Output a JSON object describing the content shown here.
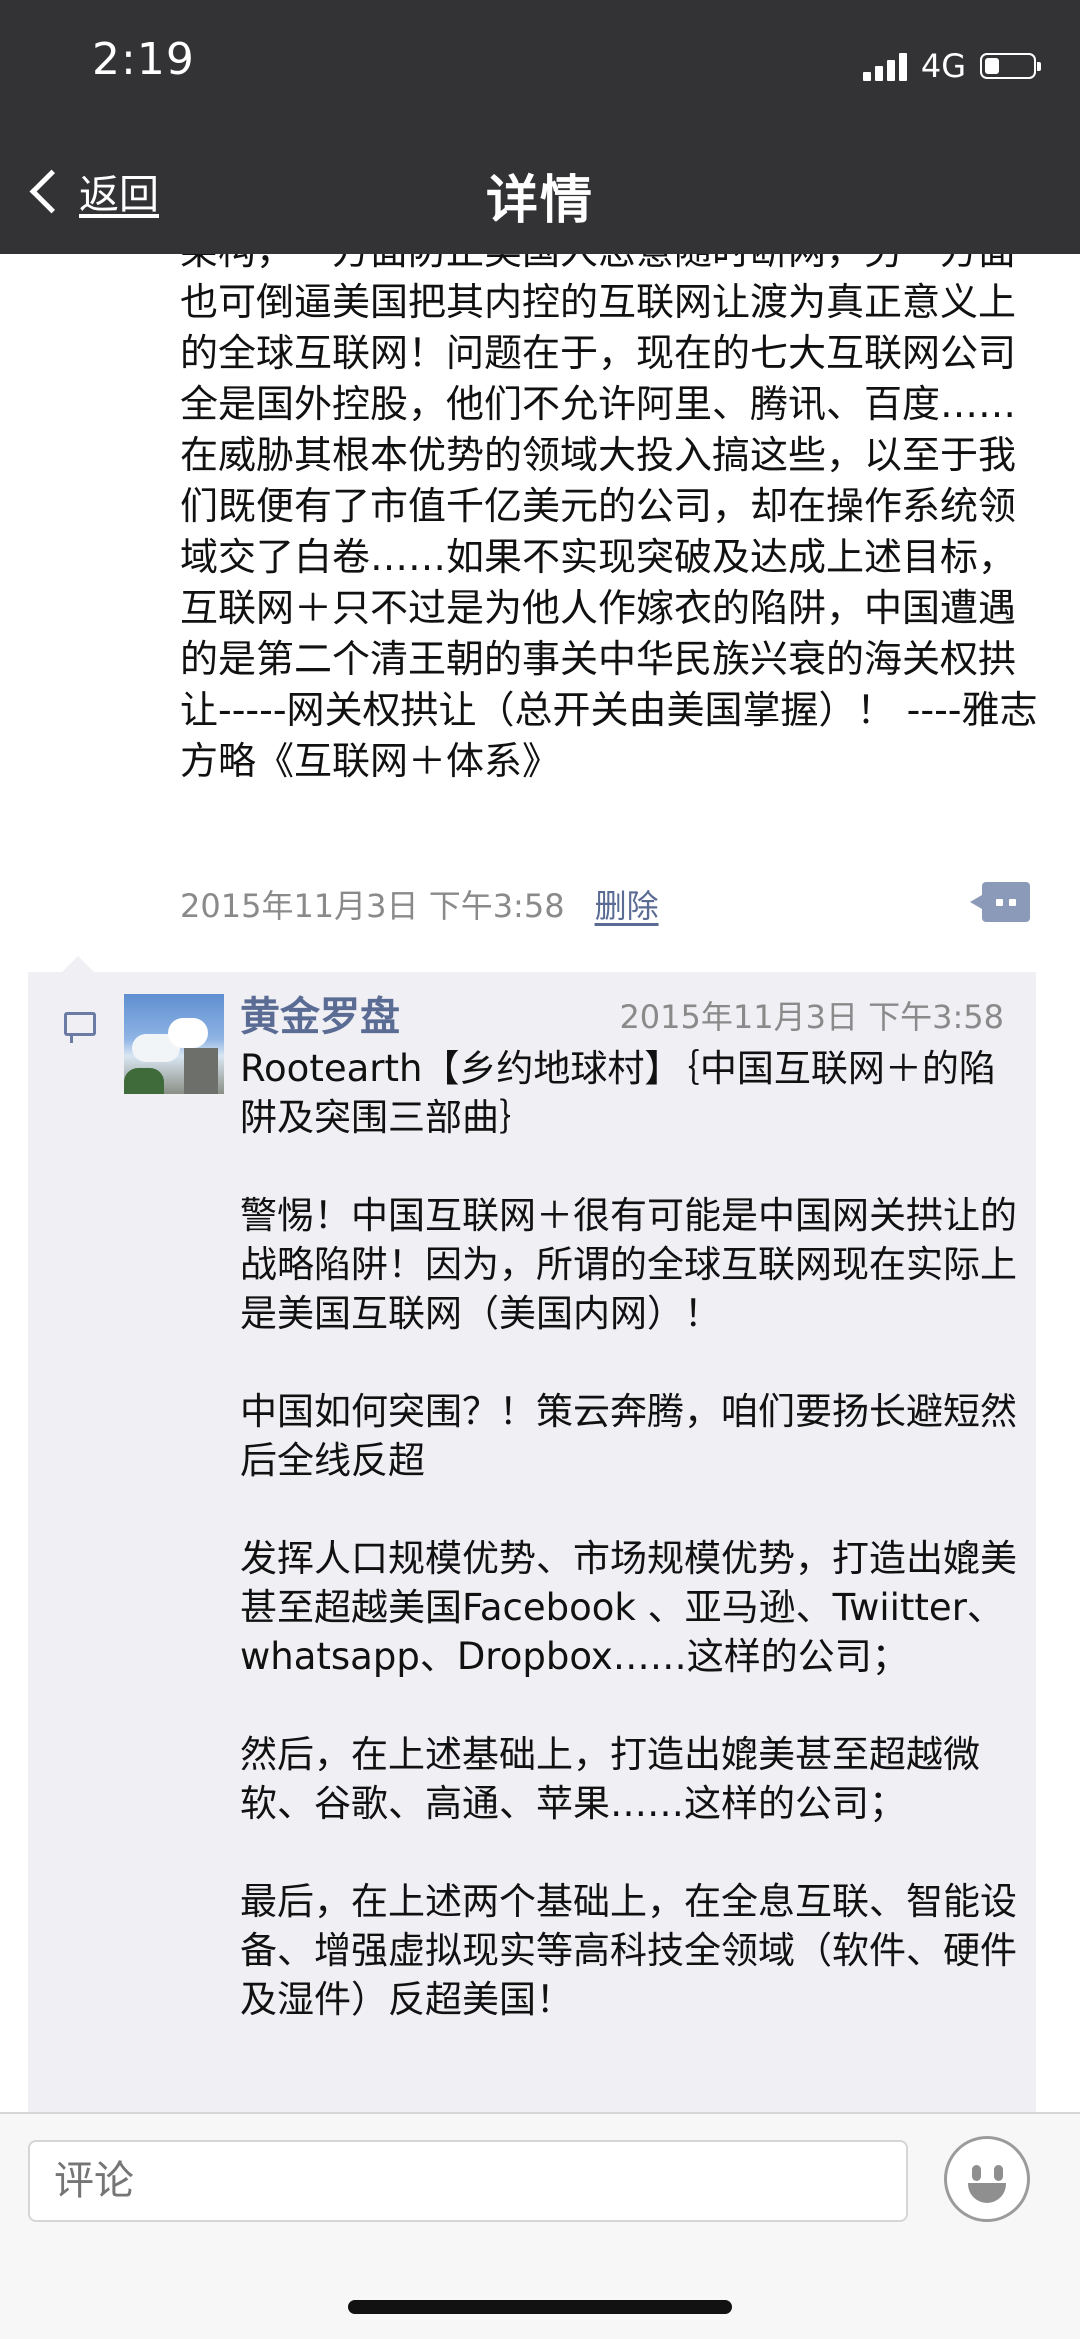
{
  "status_bar": {
    "time": "2:19",
    "network": "4G",
    "battery_level": 0.3
  },
  "nav": {
    "back_label": "返回",
    "title": "详情"
  },
  "post": {
    "text": "架构，一方面防止美国人恶意随时断网，另一方面也可倒逼美国把其内控的互联网让渡为真正意义上的全球互联网！问题在于，现在的七大互联网公司全是国外控股，他们不允许阿里、腾讯、百度……在威胁其根本优势的领域大投入搞这些，以至于我们既便有了市值千亿美元的公司，却在操作系统领域交了白卷……如果不实现突破及达成上述目标，互联网＋只不过是为他人作嫁衣的陷阱，中国遭遇的是第二个清王朝的事关中华民族兴衰的海关权拱让-----网关权拱让（总开关由美国掌握）！ ----雅志方略《互联网＋体系》",
    "time": "2015年11月3日 下午3:58",
    "delete_label": "删除"
  },
  "comment": {
    "author": "黄金罗盘",
    "time": "2015年11月3日 下午3:58",
    "text": "Rootearth【乡约地球村】｛中国互联网＋的陷阱及突围三部曲｝\n\n警惕！中国互联网＋很有可能是中国网关拱让的战略陷阱！因为，所谓的全球互联网现在实际上是美国互联网（美国内网）！\n\n中国如何突围？！策云奔腾，咱们要扬长避短然后全线反超\n\n发挥人口规模优势、市场规模优势，打造出媲美甚至超越美国Facebook 、亚马逊、Twiitter、whatsapp、Dropbox……这样的公司；\n\n然后，在上述基础上，打造出媲美甚至超越微软、谷歌、高通、苹果……这样的公司；\n\n最后，在上述两个基础上，在全息互联、智能设备、增强虚拟现实等高科技全领域（软件、硬件及湿件）反超美国！"
  },
  "input": {
    "placeholder": "评论"
  }
}
